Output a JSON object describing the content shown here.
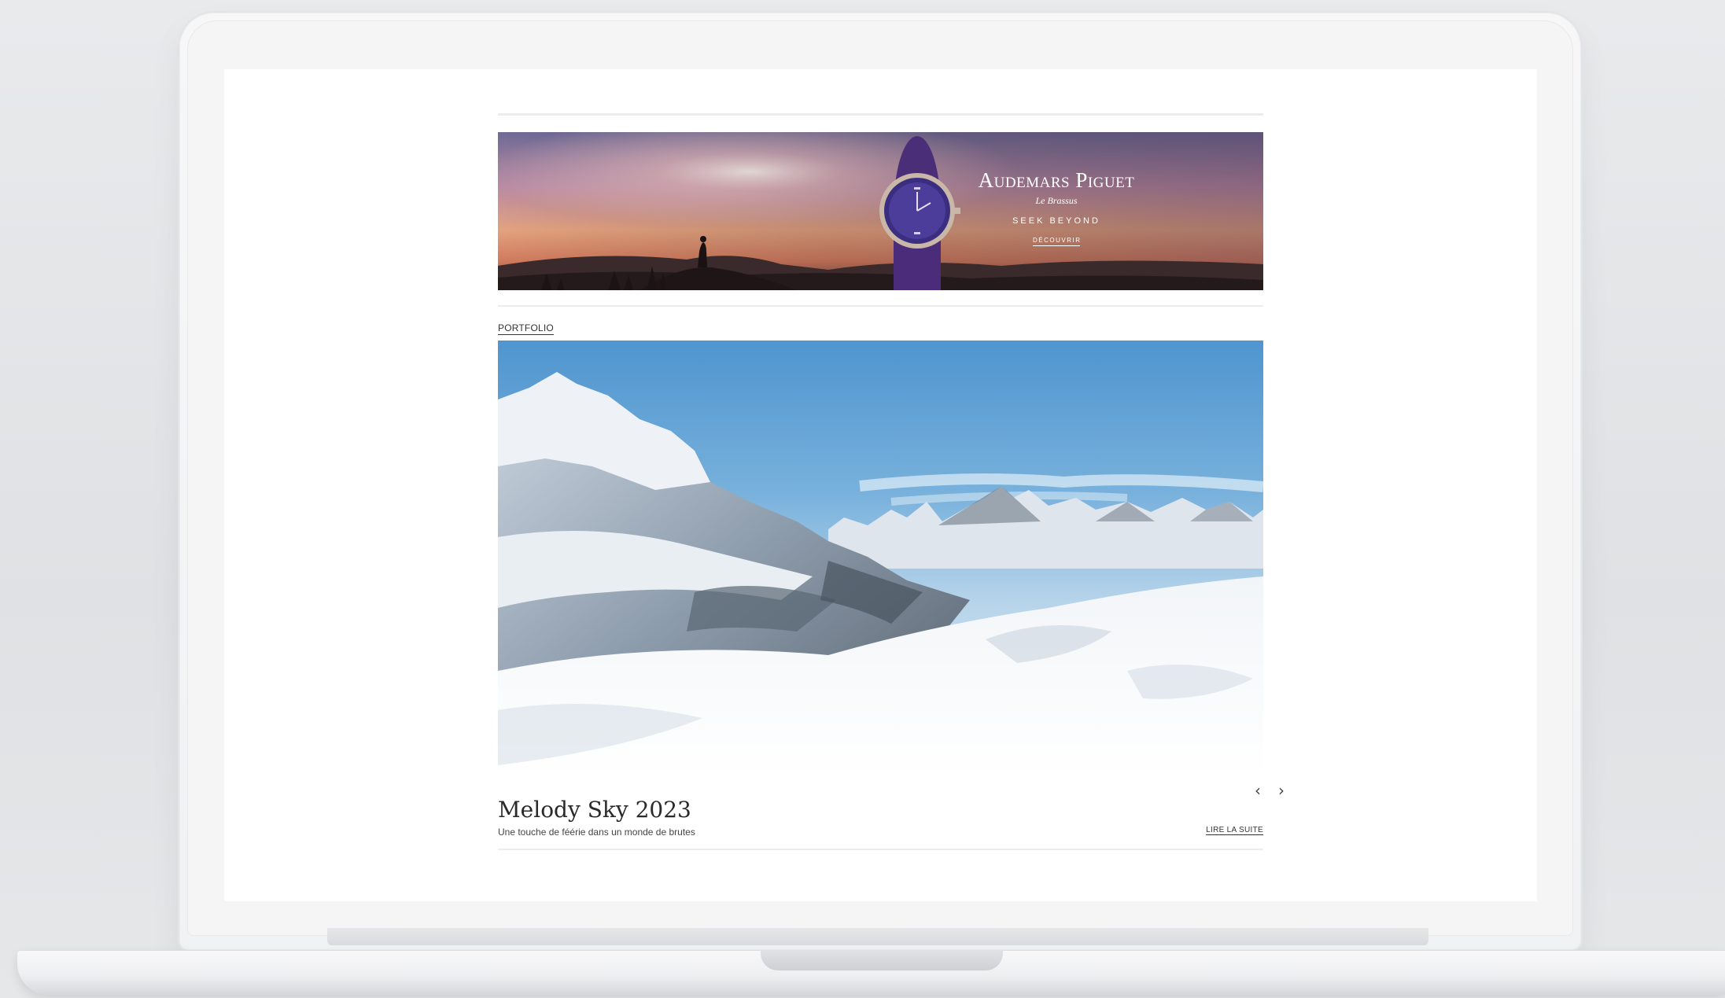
{
  "ad": {
    "brand": "Audemars Piguet",
    "sub": "Le Brassus",
    "tagline": "SEEK BEYOND",
    "cta": "DÉCOUVRIR"
  },
  "section": {
    "label": "PORTFOLIO"
  },
  "article": {
    "title": "Melody Sky 2023",
    "subtitle": "Une touche de féérie dans un monde de brutes",
    "read_more": "LIRE LA SUITE"
  },
  "carousel": {
    "prev_icon": "chevron-left-icon",
    "next_icon": "chevron-right-icon",
    "prev_glyph": "‹",
    "next_glyph": "›"
  }
}
